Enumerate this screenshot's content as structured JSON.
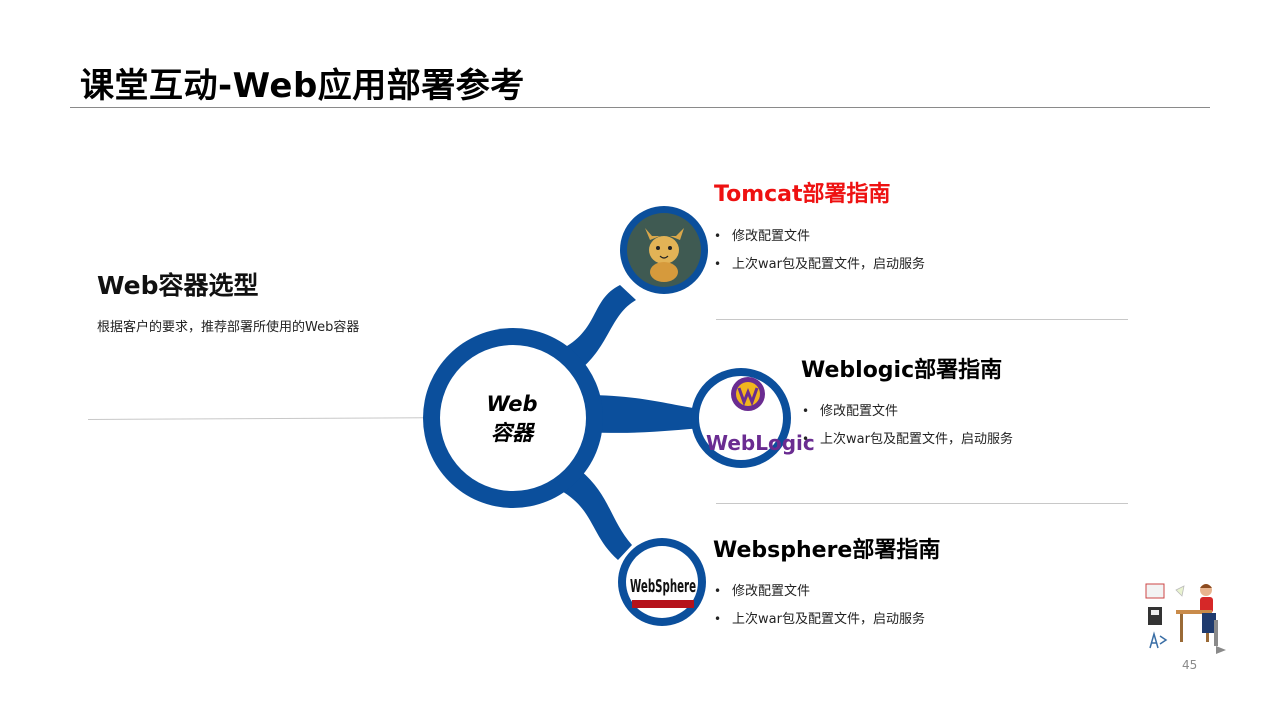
{
  "slide": {
    "title": "课堂互动-Web应用部署参考",
    "page_number": "45"
  },
  "left": {
    "heading": "Web容器选型",
    "description": "根据客户的要求，推荐部署所使用的Web容器"
  },
  "center": {
    "line1": "Web",
    "line2": "容器",
    "color": "#0b4f9c"
  },
  "sections": [
    {
      "title": "Tomcat部署指南",
      "title_color": "#ee1111",
      "icon": "tomcat-logo-icon",
      "bullets": [
        "修改配置文件",
        "上次war包及配置文件，启动服务"
      ]
    },
    {
      "title": "Weblogic部署指南",
      "title_color": "#000000",
      "icon": "weblogic-logo-icon",
      "logo_text": "WebLogic",
      "bullets": [
        "修改配置文件",
        "上次war包及配置文件，启动服务"
      ]
    },
    {
      "title": "Websphere部署指南",
      "title_color": "#000000",
      "icon": "websphere-logo-icon",
      "logo_text": "WebSphere",
      "bullets": [
        "修改配置文件",
        "上次war包及配置文件，启动服务"
      ]
    }
  ],
  "decoration": {
    "icon": "student-at-desk-clipart-icon"
  }
}
